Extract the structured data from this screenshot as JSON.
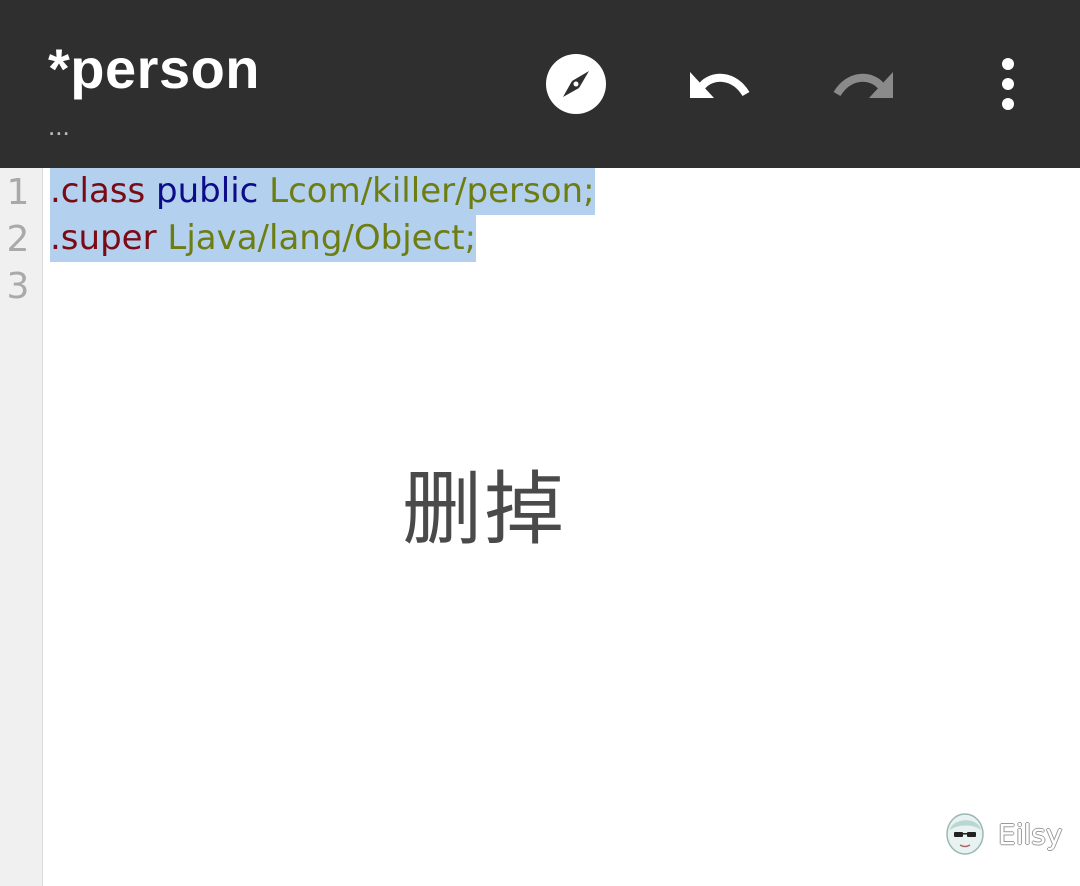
{
  "appbar": {
    "title": "*person",
    "subtitle": "...",
    "actions": [
      {
        "id": "navigate",
        "icon": "compass-icon"
      },
      {
        "id": "undo",
        "icon": "undo-icon"
      },
      {
        "id": "redo",
        "icon": "redo-icon",
        "enabled": false
      },
      {
        "id": "more",
        "icon": "more-vert-icon"
      }
    ]
  },
  "editor": {
    "line_numbers": [
      "1",
      "2",
      "3"
    ],
    "lines": [
      {
        "directive": ".class",
        "keyword": "public",
        "type": "Lcom/killer/person;"
      },
      {
        "directive": ".super",
        "type": "Ljava/lang/Object;"
      }
    ],
    "selection": "lines 1-2",
    "colors": {
      "directive": "#7a0a14",
      "keyword": "#0d0d8a",
      "type": "#6e7d12",
      "selection": "#b3d1ef",
      "appbar": "#2f2f2f"
    }
  },
  "annotation": {
    "text": "删掉"
  },
  "watermark": {
    "text": "Eilsy",
    "icon": "avatar-icon"
  }
}
